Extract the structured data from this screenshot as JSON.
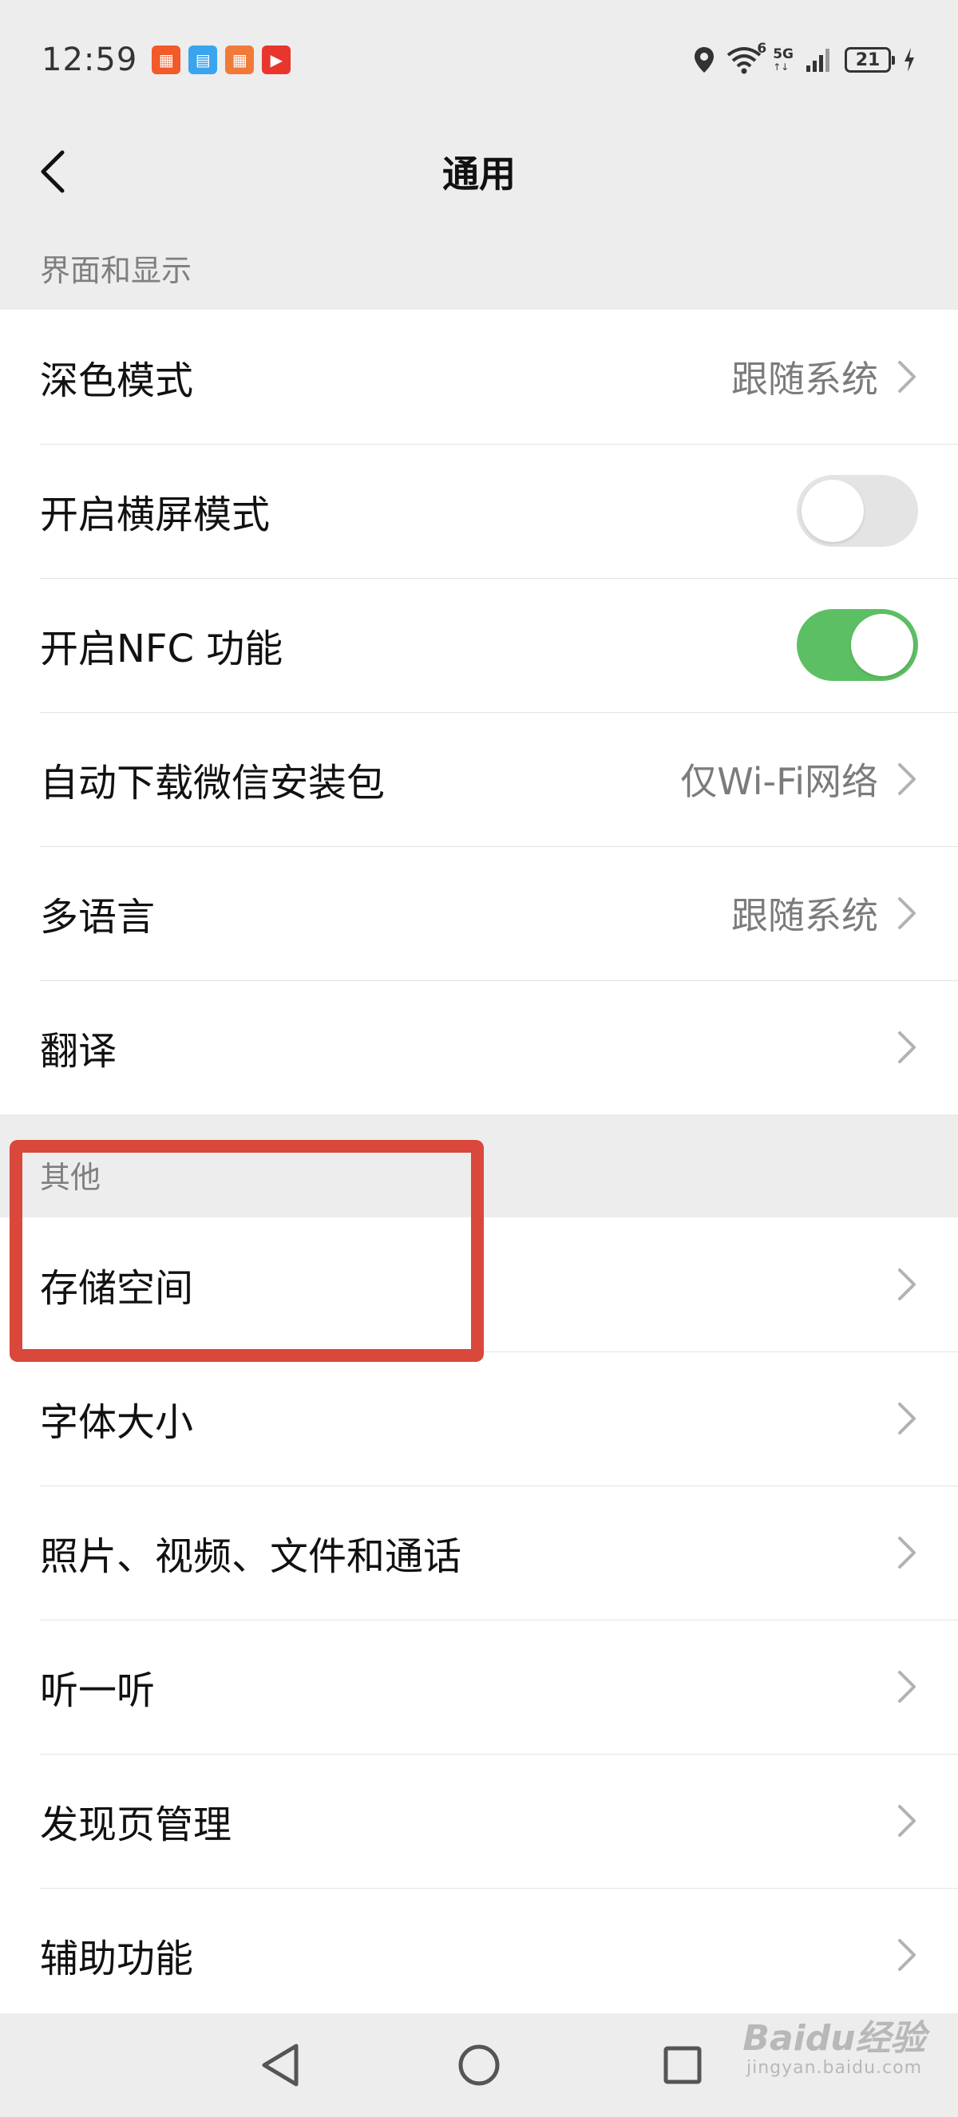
{
  "status_bar": {
    "time": "12:59",
    "battery": "21",
    "signal_labels": [
      "6",
      "5G"
    ],
    "app_icons": [
      {
        "name": "app-icon-1",
        "color": "#f25a2a"
      },
      {
        "name": "app-icon-2",
        "color": "#3aa5ee"
      },
      {
        "name": "app-icon-3",
        "color": "#f07a3a"
      },
      {
        "name": "app-icon-4",
        "color": "#e8362d"
      }
    ]
  },
  "header": {
    "title": "通用"
  },
  "sections": [
    {
      "header": "界面和显示",
      "rows": [
        {
          "label": "深色模式",
          "value": "跟随系统",
          "control": "chevron"
        },
        {
          "label": "开启横屏模式",
          "control": "toggle",
          "checked": false
        },
        {
          "label": "开启NFC 功能",
          "control": "toggle",
          "checked": true
        },
        {
          "label": "自动下载微信安装包",
          "value": "仅Wi-Fi网络",
          "control": "chevron"
        },
        {
          "label": "多语言",
          "value": "跟随系统",
          "control": "chevron"
        },
        {
          "label": "翻译",
          "control": "chevron"
        }
      ]
    },
    {
      "header": "其他",
      "rows": [
        {
          "label": "存储空间",
          "control": "chevron"
        },
        {
          "label": "字体大小",
          "control": "chevron"
        },
        {
          "label": "照片、视频、文件和通话",
          "control": "chevron"
        },
        {
          "label": "听一听",
          "control": "chevron"
        },
        {
          "label": "发现页管理",
          "control": "chevron"
        },
        {
          "label": "辅助功能",
          "control": "chevron"
        }
      ]
    }
  ],
  "colors": {
    "toggle_on": "#5dbf63",
    "toggle_off": "#e4e4e4",
    "highlight": "#d9483b"
  },
  "watermark": {
    "main": "Baidu经验",
    "sub": "jingyan.baidu.com"
  }
}
